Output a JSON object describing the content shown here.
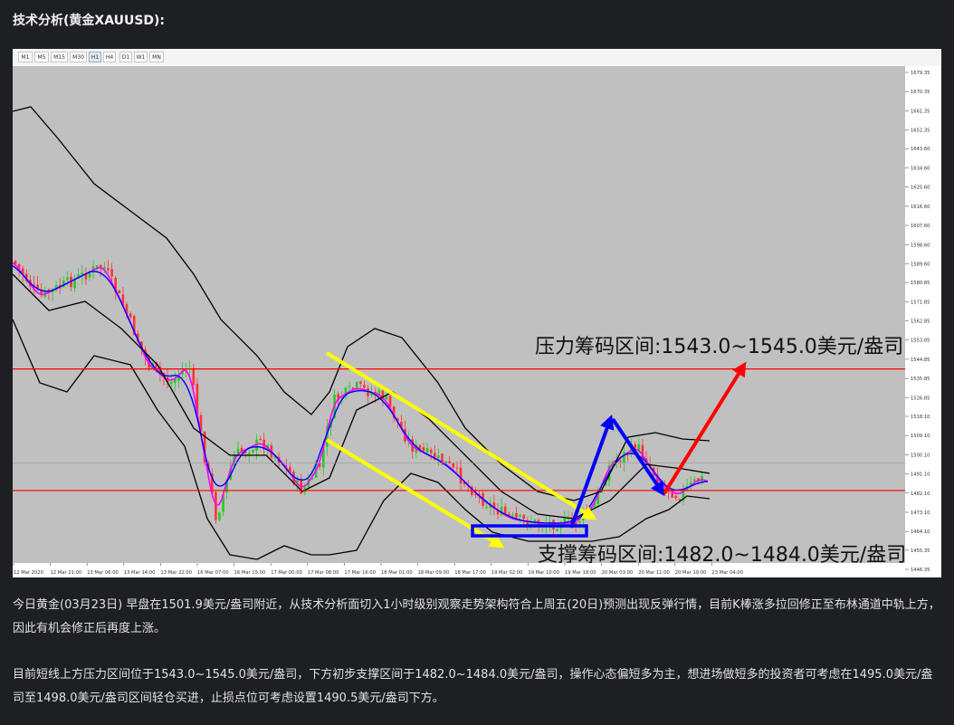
{
  "header": {
    "title": "技术分析(黄金XAUUSD):"
  },
  "toolbar": {
    "timeframes": [
      "M1",
      "M5",
      "M15",
      "M30",
      "H1",
      "H4",
      "D1",
      "W1",
      "MN"
    ],
    "active": "H1"
  },
  "chart_data": {
    "type": "candlestick",
    "symbol": "XAUUSD",
    "ylim": [
      1446.35,
      1679.35
    ],
    "y_ticks": [
      "1679.35",
      "1670.35",
      "1661.35",
      "1652.35",
      "1643.60",
      "1634.60",
      "1625.60",
      "1616.60",
      "1607.60",
      "1598.60",
      "1589.60",
      "1580.85",
      "1571.85",
      "1562.85",
      "1553.85",
      "1544.85",
      "1535.85",
      "1526.85",
      "1518.10",
      "1509.10",
      "1500.10",
      "1491.10",
      "1482.10",
      "1473.10",
      "1464.10",
      "1455.35",
      "1446.35"
    ],
    "x_ticks": [
      "12 Mar 2020",
      "12 Mar 21:00",
      "13 Mar 06:00",
      "13 Mar 14:00",
      "13 Mar 22:00",
      "16 Mar 07:00",
      "16 Mar 15:00",
      "17 Mar 00:00",
      "17 Mar 08:00",
      "17 Mar 16:00",
      "18 Mar 01:00",
      "18 Mar 09:00",
      "18 Mar 17:00",
      "19 Mar 02:00",
      "19 Mar 10:00",
      "19 Mar 18:00",
      "20 Mar 03:00",
      "20 Mar 11:00",
      "20 Mar 19:00",
      "23 Mar 04:00"
    ],
    "current_price": "1496.23",
    "levels": [
      {
        "name": "resistance",
        "value": 1540.3,
        "label": "1540.30",
        "color": "#ff0000"
      },
      {
        "name": "support",
        "value": 1483.3,
        "label": "1483.30",
        "color": "#ff0000"
      }
    ],
    "annotations": {
      "resistance_text": "压力筹码区间:1543.0~1545.0美元/盎司",
      "support_text": "支撑筹码区间:1482.0~1484.0美元/盎司"
    },
    "colors": {
      "up": "#22cc22",
      "down": "#ff3333",
      "ma_fast": "#ff00ff",
      "ma_slow": "#0000ff",
      "bands": "#000000",
      "background": "#c0c0c0"
    }
  },
  "paragraphs": {
    "p1": "今日黄金(03月23日) 早盘在1501.9美元/盎司附近，从技术分析面切入1小时级别观察走势架构符合上周五(20日)预测出现反弹行情，目前K棒涨多拉回修正至布林通道中轨上方，因此有机会修正后再度上涨。",
    "p2": "目前短线上方压力区间位于1543.0~1545.0美元/盎司，下方初步支撑区间于1482.0~1484.0美元/盎司，操作心态偏短多为主，想进场做短多的投资者可考虑在1495.0美元/盎司至1498.0美元/盎司区间轻仓买进，止损点位可考虑设置1490.5美元/盎司下方。"
  }
}
